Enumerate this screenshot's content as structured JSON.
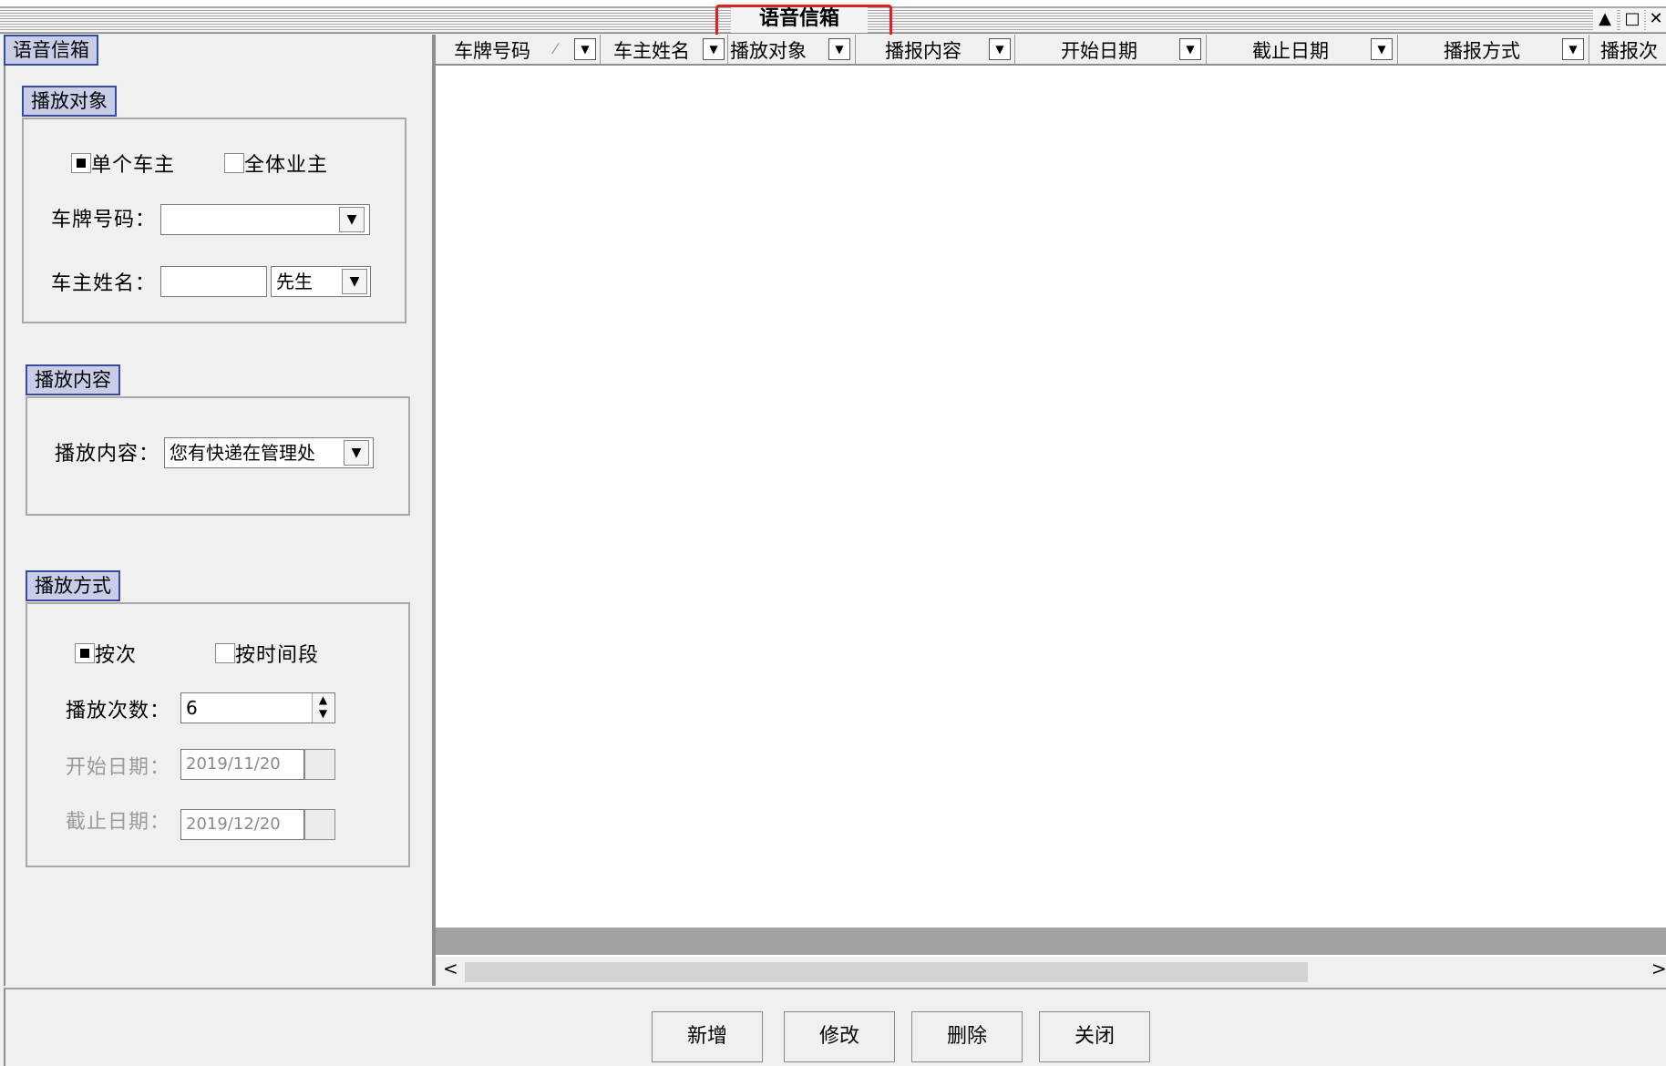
{
  "window": {
    "title": "语音信箱",
    "controls": [
      "▲",
      "□",
      "✕"
    ]
  },
  "left": {
    "tab_label": "语音信箱",
    "target_group": {
      "label": "播放对象",
      "option_single": "单个车主",
      "option_all": "全体业主",
      "single_checked": true,
      "all_checked": false,
      "plate_label": "车牌号码：",
      "plate_value": "",
      "name_label": "车主姓名：",
      "name_value": "",
      "title_value": "先生"
    },
    "content_group": {
      "label": "播放内容",
      "content_label": "播放内容：",
      "content_value": "您有快递在管理处"
    },
    "method_group": {
      "label": "播放方式",
      "option_by_count": "按次",
      "option_by_period": "按时间段",
      "by_count_checked": true,
      "by_period_checked": false,
      "count_label": "播放次数：",
      "count_value": "6",
      "start_label": "开始日期：",
      "start_value": "2019/11/20",
      "end_label": "截止日期：",
      "end_value": "2019/12/20"
    }
  },
  "grid": {
    "columns": [
      "车牌号码",
      "车主姓名",
      "播放对象",
      "播报内容",
      "开始日期",
      "截止日期",
      "播报方式",
      "播报次"
    ],
    "sort_mark": "⁄",
    "rows": []
  },
  "buttons": {
    "add": "新增",
    "edit": "修改",
    "delete": "删除",
    "close": "关闭"
  },
  "icons": {
    "dropdown": "chevron-down-icon",
    "scroll_left": "<",
    "scroll_right": ">"
  }
}
